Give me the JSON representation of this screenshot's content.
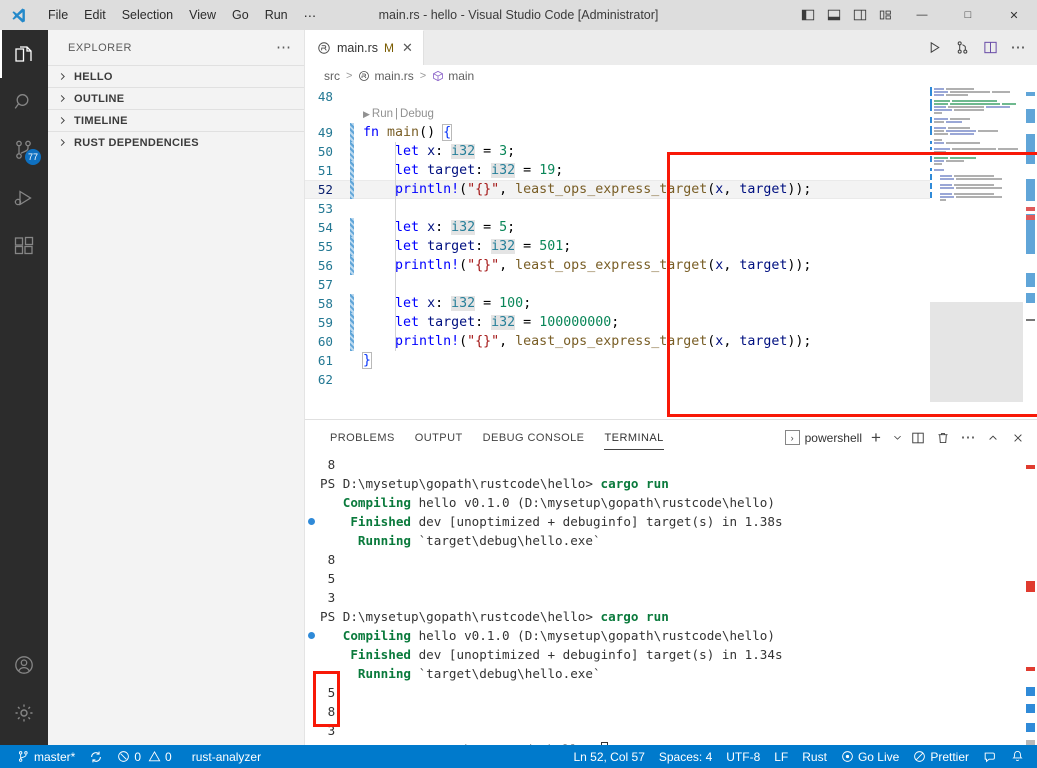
{
  "window": {
    "title": "main.rs - hello - Visual Studio Code [Administrator]",
    "menu": [
      "File",
      "Edit",
      "Selection",
      "View",
      "Go",
      "Run",
      "⋯"
    ],
    "layout_buttons": [
      {
        "name": "toggle-primary-sidebar",
        "label": "◧"
      },
      {
        "name": "toggle-panel",
        "label": "⬒"
      },
      {
        "name": "toggle-secondary-sidebar",
        "label": "◫"
      },
      {
        "name": "customize-layout",
        "label": "⊞"
      }
    ],
    "controls": {
      "minimize": "—",
      "maximize": "□",
      "close": "✕"
    }
  },
  "activity_bar": {
    "items": [
      {
        "name": "explorer",
        "icon": "files-icon",
        "active": true,
        "badge": ""
      },
      {
        "name": "search",
        "icon": "search-icon",
        "active": false,
        "badge": ""
      },
      {
        "name": "source-control",
        "icon": "source-control-icon",
        "active": false,
        "badge": "77"
      },
      {
        "name": "run-and-debug",
        "icon": "run-debug-icon",
        "active": false,
        "badge": ""
      },
      {
        "name": "extensions",
        "icon": "extensions-icon",
        "active": false,
        "badge": ""
      }
    ],
    "bottom_items": [
      {
        "name": "accounts",
        "icon": "account-icon"
      },
      {
        "name": "manage",
        "icon": "gear-icon"
      }
    ]
  },
  "sidebar": {
    "title": "EXPLORER",
    "more_actions": "⋯",
    "sections": [
      {
        "label": "HELLO",
        "expanded": false
      },
      {
        "label": "OUTLINE",
        "expanded": false
      },
      {
        "label": "TIMELINE",
        "expanded": false
      },
      {
        "label": "RUST DEPENDENCIES",
        "expanded": false
      }
    ]
  },
  "editor": {
    "tab": {
      "filename": "main.rs",
      "dirty_badge": "M",
      "close": "✕",
      "icon": "rust-file-icon"
    },
    "actions": [
      {
        "name": "run-code",
        "label": "▷"
      },
      {
        "name": "run-and-debug",
        "label": "⑂"
      },
      {
        "name": "split-editor",
        "label": "◫"
      },
      {
        "name": "more-actions",
        "label": "⋯"
      }
    ],
    "breadcrumb": [
      "src",
      "main.rs",
      "main"
    ],
    "codelens": {
      "run": "Run",
      "sep": "|",
      "debug": "Debug",
      "play": "▶"
    },
    "first_line_number": 48,
    "lines": [
      {
        "n": 48,
        "modified": false,
        "current": false,
        "tokens": []
      },
      {
        "n": 49,
        "modified": true,
        "current": false,
        "tokens": [
          {
            "t": "fn ",
            "c": "kw"
          },
          {
            "t": "main",
            "c": "fnname"
          },
          {
            "t": "() ",
            "c": "pn"
          },
          {
            "t": "{",
            "c": "brk1"
          }
        ]
      },
      {
        "n": 50,
        "modified": true,
        "current": false,
        "tokens": [
          {
            "t": "    ",
            "c": "pn"
          },
          {
            "t": "let ",
            "c": "kw"
          },
          {
            "t": "x",
            "c": "id"
          },
          {
            "t": ": ",
            "c": "pn"
          },
          {
            "t": "i32",
            "c": "typ"
          },
          {
            "t": " = ",
            "c": "pn"
          },
          {
            "t": "3",
            "c": "num"
          },
          {
            "t": ";",
            "c": "pn"
          }
        ]
      },
      {
        "n": 51,
        "modified": true,
        "current": false,
        "tokens": [
          {
            "t": "    ",
            "c": "pn"
          },
          {
            "t": "let ",
            "c": "kw"
          },
          {
            "t": "target",
            "c": "id"
          },
          {
            "t": ": ",
            "c": "pn"
          },
          {
            "t": "i32",
            "c": "typ"
          },
          {
            "t": " = ",
            "c": "pn"
          },
          {
            "t": "19",
            "c": "num"
          },
          {
            "t": ";",
            "c": "pn"
          }
        ]
      },
      {
        "n": 52,
        "modified": true,
        "current": true,
        "tokens": [
          {
            "t": "    ",
            "c": "pn"
          },
          {
            "t": "println!",
            "c": "mac"
          },
          {
            "t": "(",
            "c": "pn"
          },
          {
            "t": "\"{}\"",
            "c": "str"
          },
          {
            "t": ", ",
            "c": "pn"
          },
          {
            "t": "least_ops_express_target",
            "c": "fnname"
          },
          {
            "t": "(",
            "c": "pn"
          },
          {
            "t": "x",
            "c": "id"
          },
          {
            "t": ", ",
            "c": "pn"
          },
          {
            "t": "target",
            "c": "id"
          },
          {
            "t": "));",
            "c": "pn"
          }
        ]
      },
      {
        "n": 53,
        "modified": false,
        "current": false,
        "tokens": []
      },
      {
        "n": 54,
        "modified": true,
        "current": false,
        "tokens": [
          {
            "t": "    ",
            "c": "pn"
          },
          {
            "t": "let ",
            "c": "kw"
          },
          {
            "t": "x",
            "c": "id"
          },
          {
            "t": ": ",
            "c": "pn"
          },
          {
            "t": "i32",
            "c": "typ"
          },
          {
            "t": " = ",
            "c": "pn"
          },
          {
            "t": "5",
            "c": "num"
          },
          {
            "t": ";",
            "c": "pn"
          }
        ]
      },
      {
        "n": 55,
        "modified": true,
        "current": false,
        "tokens": [
          {
            "t": "    ",
            "c": "pn"
          },
          {
            "t": "let ",
            "c": "kw"
          },
          {
            "t": "target",
            "c": "id"
          },
          {
            "t": ": ",
            "c": "pn"
          },
          {
            "t": "i32",
            "c": "typ"
          },
          {
            "t": " = ",
            "c": "pn"
          },
          {
            "t": "501",
            "c": "num"
          },
          {
            "t": ";",
            "c": "pn"
          }
        ]
      },
      {
        "n": 56,
        "modified": true,
        "current": false,
        "tokens": [
          {
            "t": "    ",
            "c": "pn"
          },
          {
            "t": "println!",
            "c": "mac"
          },
          {
            "t": "(",
            "c": "pn"
          },
          {
            "t": "\"{}\"",
            "c": "str"
          },
          {
            "t": ", ",
            "c": "pn"
          },
          {
            "t": "least_ops_express_target",
            "c": "fnname"
          },
          {
            "t": "(",
            "c": "pn"
          },
          {
            "t": "x",
            "c": "id"
          },
          {
            "t": ", ",
            "c": "pn"
          },
          {
            "t": "target",
            "c": "id"
          },
          {
            "t": "));",
            "c": "pn"
          }
        ]
      },
      {
        "n": 57,
        "modified": false,
        "current": false,
        "tokens": []
      },
      {
        "n": 58,
        "modified": true,
        "current": false,
        "tokens": [
          {
            "t": "    ",
            "c": "pn"
          },
          {
            "t": "let ",
            "c": "kw"
          },
          {
            "t": "x",
            "c": "id"
          },
          {
            "t": ": ",
            "c": "pn"
          },
          {
            "t": "i32",
            "c": "typ"
          },
          {
            "t": " = ",
            "c": "pn"
          },
          {
            "t": "100",
            "c": "num"
          },
          {
            "t": ";",
            "c": "pn"
          }
        ]
      },
      {
        "n": 59,
        "modified": true,
        "current": false,
        "tokens": [
          {
            "t": "    ",
            "c": "pn"
          },
          {
            "t": "let ",
            "c": "kw"
          },
          {
            "t": "target",
            "c": "id"
          },
          {
            "t": ": ",
            "c": "pn"
          },
          {
            "t": "i32",
            "c": "typ"
          },
          {
            "t": " = ",
            "c": "pn"
          },
          {
            "t": "100000000",
            "c": "num"
          },
          {
            "t": ";",
            "c": "pn"
          }
        ]
      },
      {
        "n": 60,
        "modified": true,
        "current": false,
        "tokens": [
          {
            "t": "    ",
            "c": "pn"
          },
          {
            "t": "println!",
            "c": "mac"
          },
          {
            "t": "(",
            "c": "pn"
          },
          {
            "t": "\"{}\"",
            "c": "str"
          },
          {
            "t": ", ",
            "c": "pn"
          },
          {
            "t": "least_ops_express_target",
            "c": "fnname"
          },
          {
            "t": "(",
            "c": "pn"
          },
          {
            "t": "x",
            "c": "id"
          },
          {
            "t": ", ",
            "c": "pn"
          },
          {
            "t": "target",
            "c": "id"
          },
          {
            "t": "));",
            "c": "pn"
          }
        ]
      },
      {
        "n": 61,
        "modified": false,
        "current": false,
        "tokens": [
          {
            "t": "}",
            "c": "brk1"
          }
        ]
      },
      {
        "n": 62,
        "modified": false,
        "current": false,
        "tokens": []
      }
    ]
  },
  "panel": {
    "tabs": [
      {
        "label": "PROBLEMS",
        "active": false
      },
      {
        "label": "OUTPUT",
        "active": false
      },
      {
        "label": "DEBUG CONSOLE",
        "active": false
      },
      {
        "label": "TERMINAL",
        "active": true
      }
    ],
    "shell": {
      "name": "powershell",
      "glyph": "›"
    },
    "actions": [
      {
        "name": "new-terminal",
        "label": "+"
      },
      {
        "name": "terminal-dropdown",
        "label": "⌄"
      },
      {
        "name": "split-terminal",
        "label": "◫"
      },
      {
        "name": "kill-terminal",
        "label": "🗑"
      },
      {
        "name": "terminal-more",
        "label": "⋯"
      },
      {
        "name": "maximize-panel",
        "label": "∧"
      },
      {
        "name": "close-panel",
        "label": "✕"
      }
    ],
    "terminal_lines": [
      {
        "mark": "",
        "segs": [
          {
            "t": " 8"
          }
        ]
      },
      {
        "mark": "",
        "segs": [
          {
            "t": "PS D:\\mysetup\\gopath\\rustcode\\hello> "
          },
          {
            "t": "cargo run",
            "c": "t-green"
          }
        ]
      },
      {
        "mark": "",
        "segs": [
          {
            "t": "   "
          },
          {
            "t": "Compiling",
            "c": "t-green"
          },
          {
            "t": " hello v0.1.0 (D:\\mysetup\\gopath\\rustcode\\hello)"
          }
        ]
      },
      {
        "mark": "dot",
        "segs": [
          {
            "t": "    "
          },
          {
            "t": "Finished",
            "c": "t-green"
          },
          {
            "t": " dev [unoptimized + debuginfo] target(s) in 1.38s"
          }
        ]
      },
      {
        "mark": "",
        "segs": [
          {
            "t": "     "
          },
          {
            "t": "Running",
            "c": "t-green"
          },
          {
            "t": " `target\\debug\\hello.exe`"
          }
        ]
      },
      {
        "mark": "",
        "segs": [
          {
            "t": " 8"
          }
        ]
      },
      {
        "mark": "",
        "segs": [
          {
            "t": " 5"
          }
        ]
      },
      {
        "mark": "",
        "segs": [
          {
            "t": " 3"
          }
        ]
      },
      {
        "mark": "",
        "segs": [
          {
            "t": "PS D:\\mysetup\\gopath\\rustcode\\hello> "
          },
          {
            "t": "cargo run",
            "c": "t-green"
          }
        ]
      },
      {
        "mark": "dot",
        "segs": [
          {
            "t": "   "
          },
          {
            "t": "Compiling",
            "c": "t-green"
          },
          {
            "t": " hello v0.1.0 (D:\\mysetup\\gopath\\rustcode\\hello)"
          }
        ]
      },
      {
        "mark": "",
        "segs": [
          {
            "t": "    "
          },
          {
            "t": "Finished",
            "c": "t-green"
          },
          {
            "t": " dev [unoptimized + debuginfo] target(s) in 1.34s"
          }
        ]
      },
      {
        "mark": "",
        "segs": [
          {
            "t": "     "
          },
          {
            "t": "Running",
            "c": "t-green"
          },
          {
            "t": " `target\\debug\\hello.exe`"
          }
        ]
      },
      {
        "mark": "",
        "segs": [
          {
            "t": " 5"
          }
        ]
      },
      {
        "mark": "",
        "segs": [
          {
            "t": " 8"
          }
        ]
      },
      {
        "mark": "",
        "segs": [
          {
            "t": " 3"
          }
        ]
      },
      {
        "mark": "hollow",
        "segs": [
          {
            "t": "PS D:\\mysetup\\gopath\\rustcode\\hello> "
          },
          {
            "t": "",
            "c": "cursor"
          }
        ]
      }
    ]
  },
  "status_bar": {
    "left": [
      {
        "name": "remote-branch",
        "icon": "source-control-icon",
        "label": "master*"
      },
      {
        "name": "sync-changes",
        "icon": "sync-icon",
        "label": ""
      },
      {
        "name": "problems",
        "icon": "error-warning-icon",
        "label": "0 ⚠ 0",
        "errors": "0",
        "warnings": "0"
      },
      {
        "name": "rust-analyzer-status",
        "icon": "",
        "label": "rust-analyzer"
      }
    ],
    "right": [
      {
        "name": "editor-position",
        "label": "Ln 52, Col 57"
      },
      {
        "name": "indentation",
        "label": "Spaces: 4"
      },
      {
        "name": "encoding",
        "label": "UTF-8"
      },
      {
        "name": "eol",
        "label": "LF"
      },
      {
        "name": "language-mode",
        "label": "Rust"
      },
      {
        "name": "go-live",
        "icon": "broadcast-icon",
        "label": "Go Live"
      },
      {
        "name": "prettier",
        "icon": "prohibited-icon",
        "label": "Prettier"
      },
      {
        "name": "feedback",
        "icon": "feedback-icon",
        "label": ""
      },
      {
        "name": "notifications",
        "icon": "bell-icon",
        "label": ""
      }
    ]
  },
  "annotations": {
    "code_highlight_color": "#f81807",
    "terminal_highlight_color": "#f81807"
  },
  "colors": {
    "accent": "#007acc",
    "titlebar_bg": "#dddddd",
    "activitybar_bg": "#2c2c2c",
    "sidebar_bg": "#f3f3f3",
    "editor_bg": "#ffffff"
  }
}
